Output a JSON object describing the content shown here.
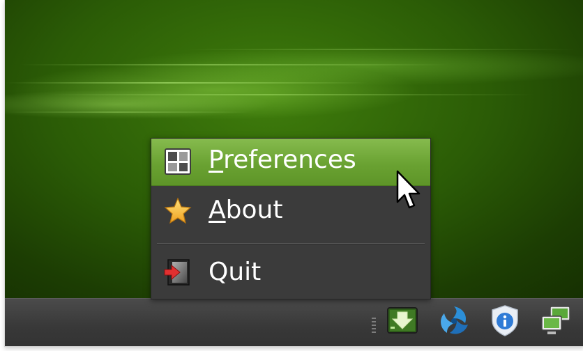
{
  "menu": {
    "items": [
      {
        "mnemonic": "P",
        "rest": "references",
        "icon": "preferences-icon",
        "highlighted": true
      },
      {
        "mnemonic": "A",
        "rest": "bout",
        "icon": "star-icon",
        "highlighted": false
      },
      {
        "mnemonic": "",
        "rest": "Quit",
        "icon": "exit-icon",
        "highlighted": false
      }
    ]
  },
  "tray": {
    "icons": [
      "update-download-icon",
      "swirl-app-icon",
      "security-shield-icon",
      "network-computers-icon"
    ]
  },
  "colors": {
    "highlight": "#6aa232",
    "menu_background": "#3b3b3b",
    "taskbar": "#383838",
    "wallpaper": "#2b5c06"
  }
}
